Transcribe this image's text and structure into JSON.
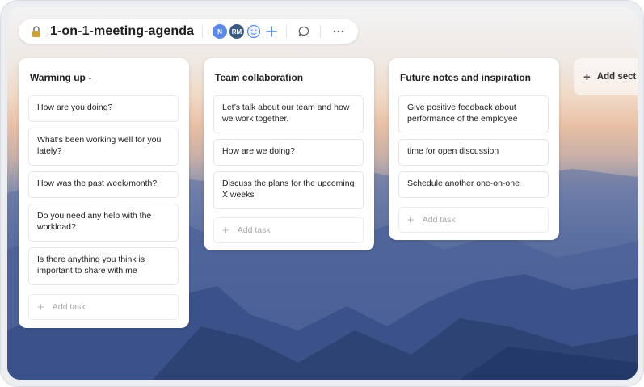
{
  "project": {
    "title": "1-on-1-meeting-agenda"
  },
  "toolbar": {
    "avatars": [
      {
        "initials": "N",
        "color": "#5b8be6"
      },
      {
        "initials": "RM",
        "color": "#3d5a80"
      }
    ]
  },
  "sections": [
    {
      "title": "Warming up -",
      "tasks": [
        "How are you doing?",
        "What’s been working well for you lately?",
        "How was the past week/month?",
        "Do you need any help with the workload?",
        "Is there anything you think is important to share with me"
      ],
      "add_task_label": "Add task"
    },
    {
      "title": "Team collaboration",
      "tasks": [
        "Let’s talk about our team and how we work together.",
        "How are we doing?",
        "Discuss the plans for the upcoming X weeks"
      ],
      "add_task_label": "Add task"
    },
    {
      "title": "Future notes and inspiration",
      "tasks": [
        "Give positive feedback about performance of the employee",
        "time for open discussion",
        "Schedule another one-on-one"
      ],
      "add_task_label": "Add task"
    }
  ],
  "add_section_label": "Add sect"
}
